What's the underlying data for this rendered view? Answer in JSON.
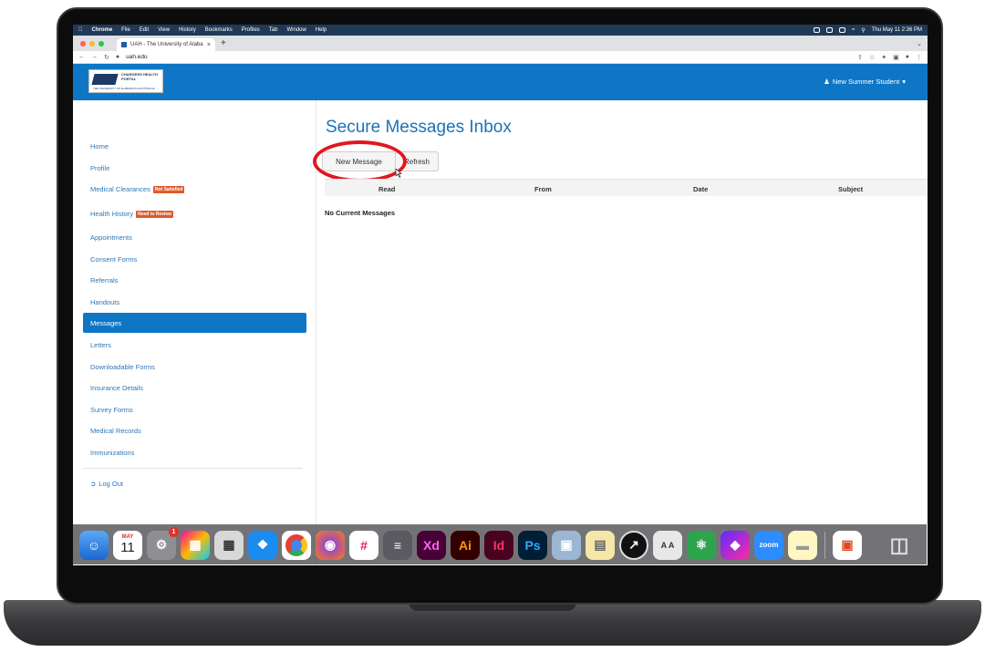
{
  "menubar": {
    "app_name": "Chrome",
    "items": [
      "File",
      "Edit",
      "View",
      "History",
      "Bookmarks",
      "Profiles",
      "Tab",
      "Window",
      "Help"
    ],
    "clock": "Thu May 11  2:36 PM"
  },
  "browser": {
    "tab_title": "UAH - The University of Alaba",
    "new_tab": "+",
    "url": "uah.edu"
  },
  "header": {
    "logo_title": "CHARGERS HEALTH PORTAL",
    "logo_subtitle": "THE UNIVERSITY OF ALABAMA IN HUNTSVILLE",
    "user_label": "New Summer Student"
  },
  "sidebar": {
    "items": [
      {
        "label": "Home"
      },
      {
        "label": "Profile"
      },
      {
        "label": "Medical Clearances",
        "badge": "Not Satisfied"
      },
      {
        "label": "Health History",
        "badge": "Need to Review"
      },
      {
        "label": "Appointments"
      },
      {
        "label": "Consent Forms"
      },
      {
        "label": "Referrals"
      },
      {
        "label": "Handouts"
      },
      {
        "label": "Messages",
        "active": true
      },
      {
        "label": "Letters"
      },
      {
        "label": "Downloadable Forms"
      },
      {
        "label": "Insurance Details"
      },
      {
        "label": "Survey Forms"
      },
      {
        "label": "Medical Records"
      },
      {
        "label": "Immunizations"
      }
    ],
    "logout_label": "Log Out"
  },
  "main": {
    "title": "Secure Messages Inbox",
    "new_message_label": "New Message",
    "refresh_label": "Refresh",
    "columns": [
      "Read",
      "From",
      "Date",
      "Subject"
    ],
    "empty_text": "No Current Messages"
  },
  "dock": {
    "calendar_month": "MAY",
    "calendar_day": "11",
    "settings_badge": "1",
    "labels": {
      "xd": "Xd",
      "ai": "Ai",
      "id": "Id",
      "ps": "Ps",
      "zoom": "zoom",
      "fonts": "A A"
    }
  },
  "colors": {
    "brand_blue": "#0f76c5",
    "badge_orange": "#e05a2b",
    "highlight_red": "#e1171e"
  }
}
